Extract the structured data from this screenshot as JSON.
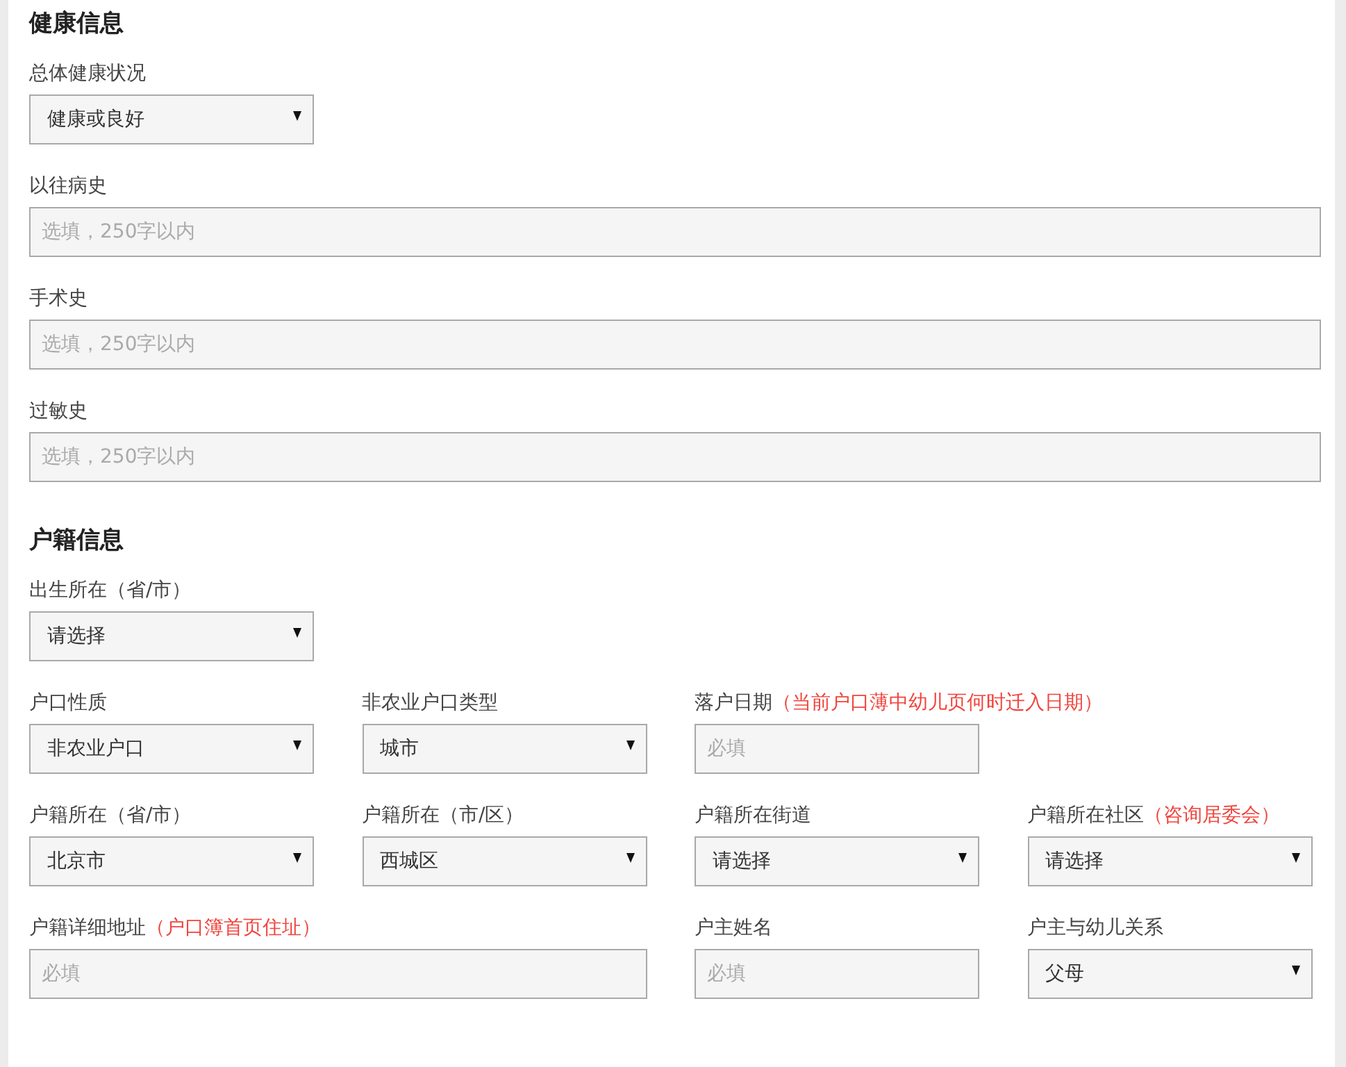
{
  "sections": [
    {
      "title": "健康信息",
      "rows": [
        [
          {
            "kind": "select",
            "label": "总体健康状况",
            "value": "健康或良好"
          }
        ],
        [
          {
            "kind": "text",
            "label": "以往病史",
            "placeholder": "选填，250字以内"
          }
        ],
        [
          {
            "kind": "text",
            "label": "手术史",
            "placeholder": "选填，250字以内"
          }
        ],
        [
          {
            "kind": "text",
            "label": "过敏史",
            "placeholder": "选填，250字以内"
          }
        ]
      ]
    },
    {
      "title": "户籍信息",
      "rows": [
        [
          {
            "kind": "select",
            "label": "出生所在（省/市）",
            "value": "请选择"
          }
        ],
        [
          {
            "kind": "select",
            "label": "户口性质",
            "value": "非农业户口"
          },
          {
            "kind": "select",
            "label": "非农业户口类型",
            "value": "城市"
          },
          {
            "kind": "text",
            "label": "落户日期",
            "note": "（当前户口薄中幼儿页何时迁入日期）",
            "placeholder": "必填"
          }
        ],
        [
          {
            "kind": "select",
            "label": "户籍所在（省/市）",
            "value": "北京市"
          },
          {
            "kind": "select",
            "label": "户籍所在（市/区）",
            "value": "西城区"
          },
          {
            "kind": "select",
            "label": "户籍所在街道",
            "value": "请选择"
          },
          {
            "kind": "select",
            "label": "户籍所在社区",
            "note": "（咨询居委会）",
            "value": "请选择"
          }
        ],
        [
          {
            "kind": "text",
            "label": "户籍详细地址",
            "note": "（户口簿首页住址）",
            "placeholder": "必填"
          },
          "",
          {
            "kind": "text",
            "label": "户主姓名",
            "placeholder": "必填"
          },
          {
            "kind": "select",
            "label": "户主与幼儿关系",
            "value": "父母"
          }
        ]
      ]
    }
  ]
}
